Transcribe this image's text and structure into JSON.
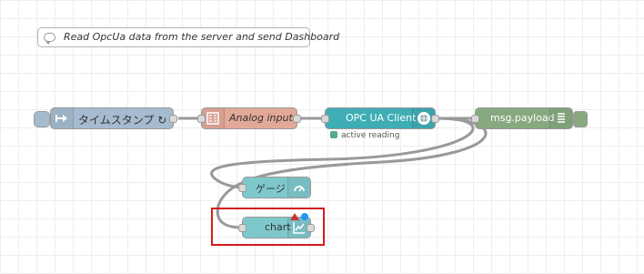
{
  "comment": {
    "text": "Read OpcUa data from the server and send Dashboard",
    "icon": "comment-icon"
  },
  "nodes": {
    "inject": {
      "label": "タイムスタンプ ↻",
      "color": "#a6bbcf",
      "icon": "arrow-right-icon"
    },
    "analog": {
      "label": "Analog input",
      "color": "#e2a898",
      "icon": "template-icon"
    },
    "opcua": {
      "label": "OPC UA Client",
      "color": "#3fadb5",
      "icon": "opcua-icon",
      "status": "active reading",
      "status_color": "#55aa88"
    },
    "debug": {
      "label": "msg.payload",
      "color": "#87a980",
      "icon": "list-icon"
    },
    "gauge": {
      "label": "ゲージ",
      "color": "#7ec8cc",
      "icon": "gauge-icon"
    },
    "chart": {
      "label": "chart",
      "color": "#7ec8cc",
      "icon": "chart-icon"
    }
  },
  "highlight_color": "#d51b1b"
}
